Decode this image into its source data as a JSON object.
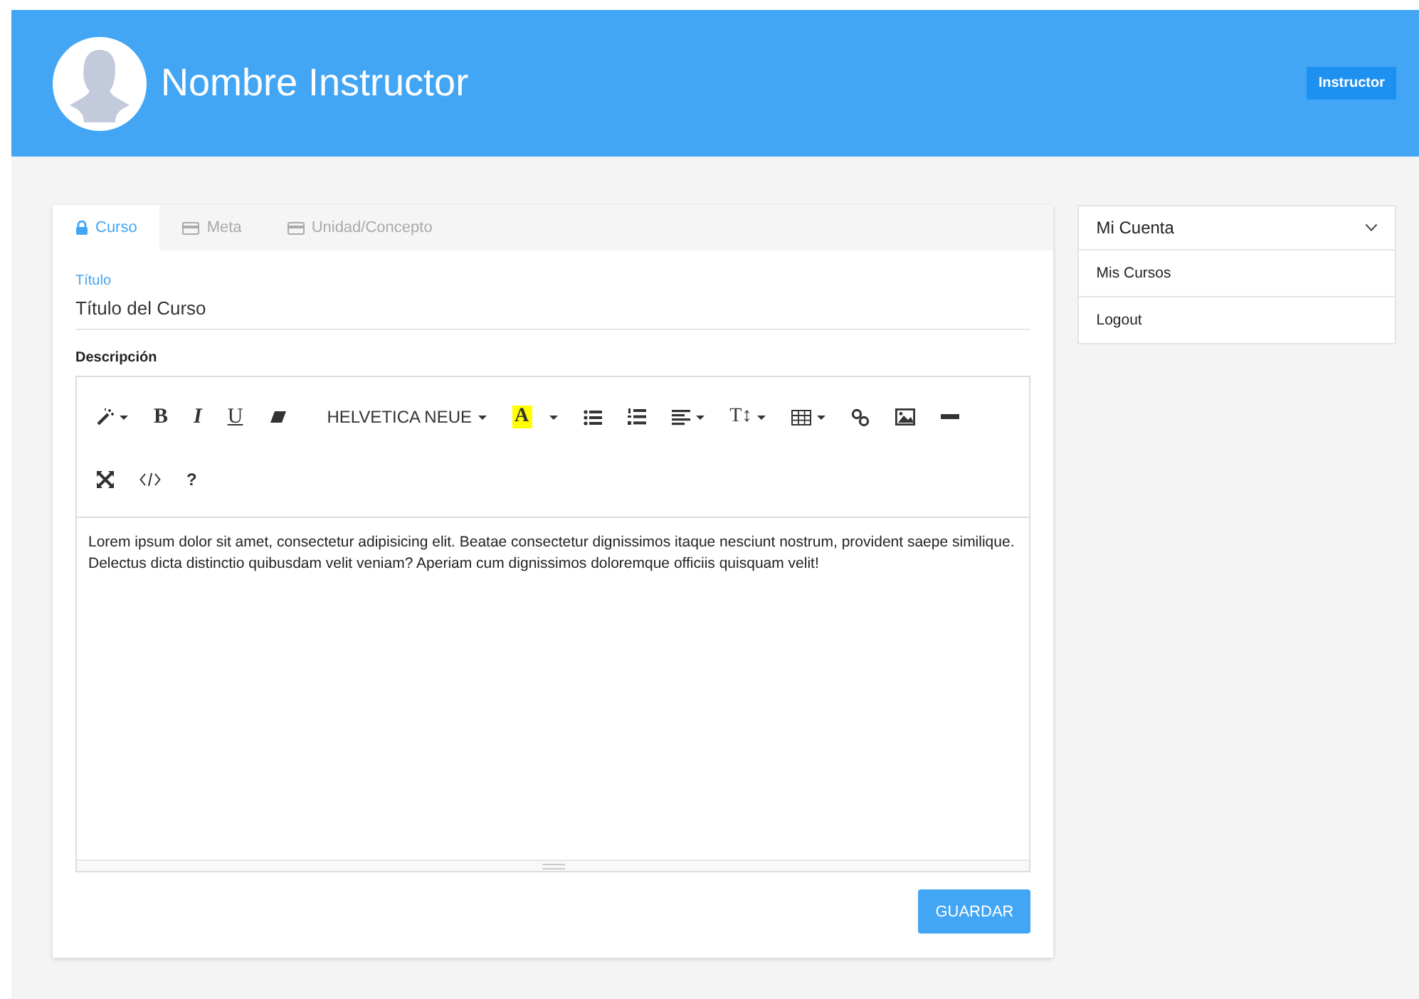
{
  "header": {
    "name": "Nombre Instructor",
    "role_badge": "Instructor"
  },
  "tabs": [
    {
      "label": "Curso",
      "kind": "lock",
      "selected": true
    },
    {
      "label": "Meta",
      "kind": "card",
      "selected": false
    },
    {
      "label": "Unidad/Concepto",
      "kind": "card",
      "selected": false
    }
  ],
  "title_field": {
    "label": "Título",
    "value": "Título del Curso"
  },
  "description": {
    "label": "Descripción",
    "toolbar": [
      [
        {
          "kind": "magic",
          "caret": true
        },
        {
          "kind": "bold",
          "label": "B",
          "caret": false
        },
        {
          "kind": "italic",
          "label": "I",
          "caret": false
        },
        {
          "kind": "underline",
          "label": "U",
          "caret": false
        },
        {
          "kind": "eraser",
          "caret": false
        },
        {
          "kind": "font",
          "label": "HELVETICA NEUE",
          "caret": true
        },
        {
          "kind": "highlight",
          "label": "A",
          "caret": true
        },
        {
          "kind": "bullets",
          "caret": false
        },
        {
          "kind": "numbers",
          "caret": false
        },
        {
          "kind": "align",
          "caret": true
        },
        {
          "kind": "size",
          "label": "T↕",
          "caret": true
        },
        {
          "kind": "table",
          "caret": true
        },
        {
          "kind": "link",
          "caret": false
        },
        {
          "kind": "image",
          "caret": false
        },
        {
          "kind": "rule",
          "caret": false
        }
      ],
      [
        {
          "kind": "fullscreen",
          "caret": false
        },
        {
          "kind": "code",
          "caret": false
        },
        {
          "kind": "help",
          "label": "?",
          "caret": false
        }
      ]
    ],
    "text": "Lorem ipsum dolor sit amet, consectetur adipisicing elit. Beatae consectetur dignissimos itaque nesciunt nostrum, provident saepe similique. Delectus dicta distinctio quibusdam velit veniam? Aperiam cum dignissimos doloremque officiis quisquam velit!"
  },
  "save_button": "GUARDAR",
  "account_menu": {
    "title": "Mi Cuenta",
    "expanded": true,
    "items": [
      "Mis Cursos",
      "Logout"
    ]
  }
}
